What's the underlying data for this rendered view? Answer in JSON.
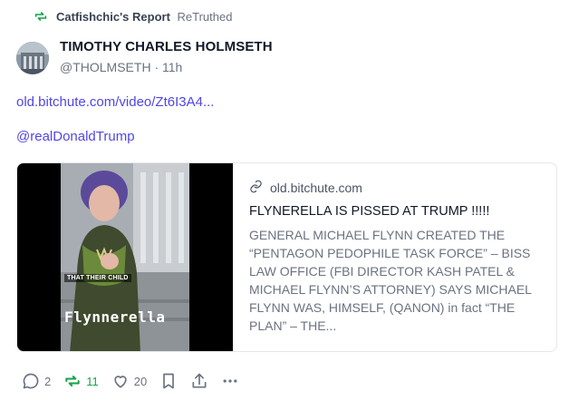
{
  "retruth": {
    "user": "Catfishchic's Report",
    "suffix": "ReTruthed"
  },
  "author": {
    "name": "TIMOTHY CHARLES HOLMSETH",
    "handle": "@THOLMSETH",
    "separator": "·",
    "time": "11h"
  },
  "post": {
    "link_text": "old.bitchute.com/video/Zt6I3A4...",
    "mention": "@realDonaldTrump"
  },
  "card": {
    "domain": "old.bitchute.com",
    "title": "FLYNERELLA IS PISSED AT TRUMP !!!!!",
    "description": "GENERAL MICHAEL FLYNN CREATED THE “PENTAGON PEDOPHILE TASK FORCE” – BISS LAW OFFICE (FBI DIRECTOR KASH PATEL & MICHAEL FLYNN’S ATTORNEY) SAYS MICHAEL FLYNN WAS, HIMSELF, (QANON) in fact “THE PLAN” – THE...",
    "thumb_caption_small": "THAT THEIR CHILD",
    "thumb_caption_big": "Flynnerella"
  },
  "actions": {
    "replies": "2",
    "retruths": "11",
    "likes": "20"
  },
  "colors": {
    "link": "#4f46e5",
    "retruth_green": "#16a34a",
    "muted": "#6b7280"
  },
  "icons": [
    "retruth-icon",
    "link-icon",
    "reply-icon",
    "like-icon",
    "bookmark-icon",
    "share-icon",
    "more-icon"
  ]
}
